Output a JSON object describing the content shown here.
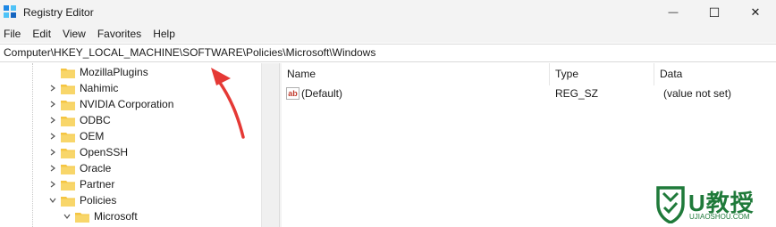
{
  "window": {
    "title": "Registry Editor",
    "minimize_glyph": "—",
    "maximize_glyph": "☐",
    "close_glyph": "✕"
  },
  "menu": {
    "items": [
      "File",
      "Edit",
      "View",
      "Favorites",
      "Help"
    ]
  },
  "address": {
    "path": "Computer\\HKEY_LOCAL_MACHINE\\SOFTWARE\\Policies\\Microsoft\\Windows"
  },
  "tree": {
    "items": [
      {
        "label": "MozillaPlugins",
        "expanded": false,
        "has_chevron": false
      },
      {
        "label": "Nahimic",
        "expanded": false,
        "has_chevron": true
      },
      {
        "label": "NVIDIA Corporation",
        "expanded": false,
        "has_chevron": true
      },
      {
        "label": "ODBC",
        "expanded": false,
        "has_chevron": true
      },
      {
        "label": "OEM",
        "expanded": false,
        "has_chevron": true
      },
      {
        "label": "OpenSSH",
        "expanded": false,
        "has_chevron": true
      },
      {
        "label": "Oracle",
        "expanded": false,
        "has_chevron": true
      },
      {
        "label": "Partner",
        "expanded": false,
        "has_chevron": true
      },
      {
        "label": "Policies",
        "expanded": true,
        "has_chevron": true
      },
      {
        "label": "Microsoft",
        "expanded": true,
        "has_chevron": true
      }
    ]
  },
  "values_pane": {
    "columns": {
      "name": "Name",
      "type": "Type",
      "data": "Data"
    },
    "rows": [
      {
        "icon": "ab",
        "name": "(Default)",
        "type": "REG_SZ",
        "data": "(value not set)"
      }
    ]
  },
  "watermark": {
    "main": "U教授",
    "sub": "UJIAOSHOU.COM"
  },
  "colors": {
    "folder": "#f5c542",
    "arrow": "#e53935",
    "watermark": "#1f7a3a"
  }
}
